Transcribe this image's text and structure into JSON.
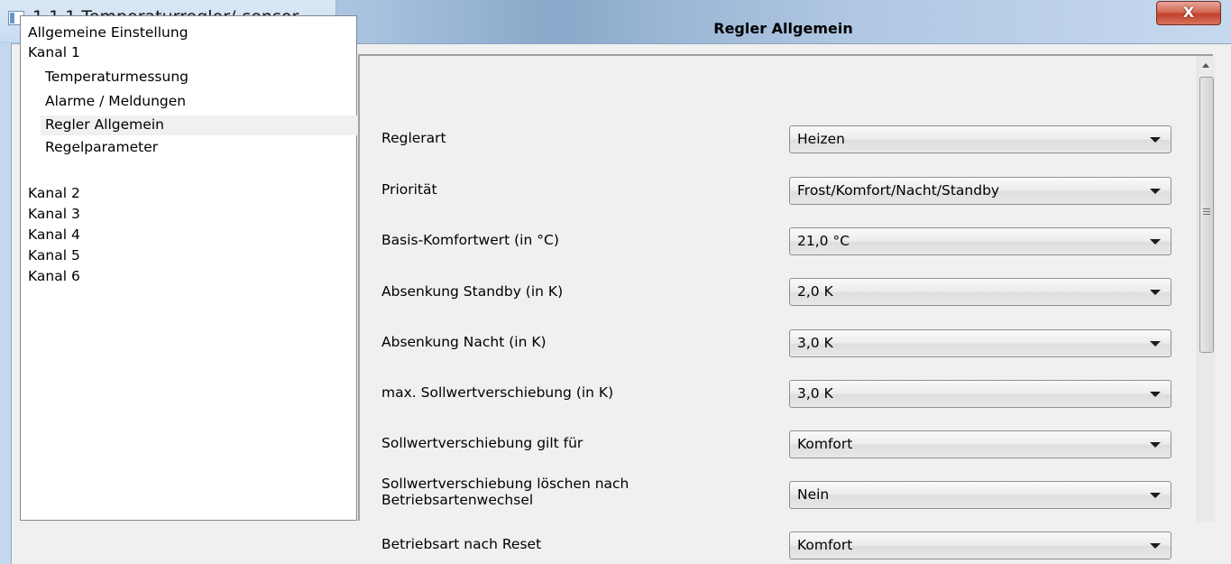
{
  "window": {
    "title": "1.1.1 Temperaturregler/-sensor",
    "close_label": "X"
  },
  "tree": {
    "items": [
      {
        "label": "Allgemeine Einstellung",
        "level": 0,
        "selected": false
      },
      {
        "label": "Kanal 1",
        "level": 0,
        "selected": false
      },
      {
        "label": "Temperaturmessung",
        "level": 1,
        "selected": false
      },
      {
        "label": "Alarme / Meldungen",
        "level": 1,
        "selected": false
      },
      {
        "label": "Regler Allgemein",
        "level": 1,
        "selected": true
      },
      {
        "label": "Regelparameter",
        "level": 1,
        "selected": false
      },
      {
        "label": "Kanal 2",
        "level": 0,
        "selected": false
      },
      {
        "label": "Kanal 3",
        "level": 0,
        "selected": false
      },
      {
        "label": "Kanal 4",
        "level": 0,
        "selected": false
      },
      {
        "label": "Kanal 5",
        "level": 0,
        "selected": false
      },
      {
        "label": "Kanal 6",
        "level": 0,
        "selected": false
      }
    ]
  },
  "panel": {
    "title": "Regler Allgemein",
    "params": [
      {
        "label": "Reglerart",
        "value": "Heizen"
      },
      {
        "label": "Priorität",
        "value": "Frost/Komfort/Nacht/Standby"
      },
      {
        "label": "Basis-Komfortwert (in °C)",
        "value": "21,0 °C"
      },
      {
        "label": "Absenkung Standby (in K)",
        "value": "2,0 K"
      },
      {
        "label": "Absenkung Nacht (in K)",
        "value": "3,0 K"
      },
      {
        "label": "max. Sollwertverschiebung (in K)",
        "value": "3,0 K"
      },
      {
        "label": "Sollwertverschiebung gilt für",
        "value": "Komfort"
      },
      {
        "label": "Sollwertverschiebung löschen nach",
        "label2": "Betriebsartenwechsel",
        "value": "Nein"
      },
      {
        "label": "Betriebsart nach Reset",
        "value": "Komfort"
      }
    ]
  }
}
